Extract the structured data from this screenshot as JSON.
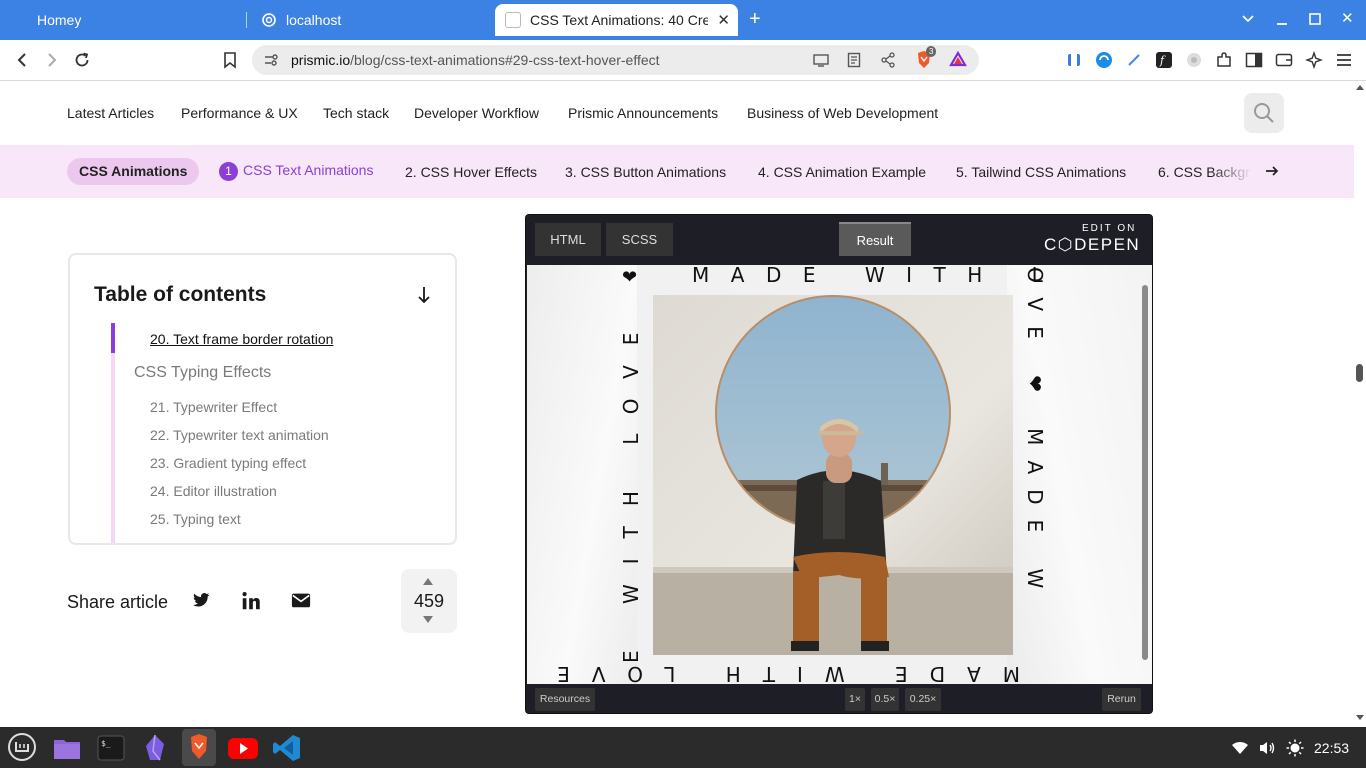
{
  "browser": {
    "tabs": [
      {
        "title": "Homey"
      },
      {
        "title": "localhost"
      },
      {
        "title": "CSS Text Animations: 40 Crea"
      }
    ],
    "url_domain": "prismic.io",
    "url_path": "/blog/css-text-animations#29-css-text-hover-effect",
    "brave_badge": "3"
  },
  "topnav": {
    "items": [
      "Latest Articles",
      "Performance & UX",
      "Tech stack",
      "Developer Workflow",
      "Prismic Announcements",
      "Business of Web Development"
    ]
  },
  "subnav": {
    "pill": "CSS Animations",
    "current_num": "1",
    "current": "CSS Text Animations",
    "items": [
      "2. CSS Hover Effects",
      "3. CSS Button Animations",
      "4. CSS Animation Example",
      "5. Tailwind CSS Animations",
      "6. CSS Backgr"
    ]
  },
  "toc": {
    "title": "Table of contents",
    "active_item": "20. Text frame border rotation",
    "section": "CSS Typing Effects",
    "items": [
      "21. Typewriter Effect",
      "22. Typewriter text animation",
      "23. Gradient typing effect",
      "24. Editor illustration",
      "25. Typing text"
    ]
  },
  "share": {
    "label": "Share article",
    "votes": "459"
  },
  "codepen": {
    "tabs": [
      "HTML",
      "SCSS"
    ],
    "result": "Result",
    "edit_on": "EDIT ON",
    "logo": "C⬡DEPEN",
    "frame_text_top": "MADE WITH L",
    "frame_text_left": "E WITH LOVE",
    "frame_text_right": "OVE ❤ MADE W",
    "frame_text_bottom": "MADE WITH LOVE ❤",
    "footer": {
      "resources": "Resources",
      "zoom": [
        "1×",
        "0.5×",
        "0.25×"
      ],
      "rerun": "Rerun"
    }
  },
  "taskbar": {
    "time": "22:53"
  },
  "colors": {
    "tabbar": "#3b82e4",
    "accent": "#8a3fd6",
    "subnav_bg": "#f8e7f8"
  }
}
